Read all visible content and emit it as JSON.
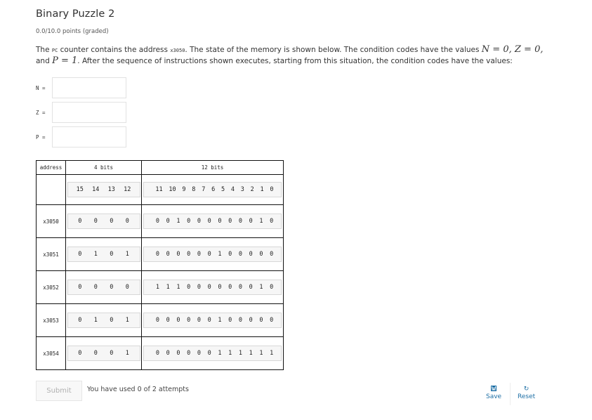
{
  "problem": {
    "title": "Binary Puzzle 2",
    "points": "0.0/10.0 points (graded)",
    "prompt": {
      "part1": "The ",
      "pc_label": "PC",
      "part2": " counter contains the address ",
      "pc_address": "x3050",
      "part3": ". The state of the memory is shown below. The condition codes have the values ",
      "n_var": "N",
      "n_eq": " = 0",
      "comma1": ", ",
      "z_var": "Z",
      "z_eq": " = 0",
      "comma2": ",",
      "part4": "and ",
      "p_var": "P",
      "p_eq": " = 1",
      "part5": ". After the sequence of instructions shown executes, starting from this situation, the condition codes have the values:"
    }
  },
  "condition_codes": [
    {
      "label": "N =",
      "value": "",
      "placeholder": ""
    },
    {
      "label": "Z =",
      "value": "",
      "placeholder": ""
    },
    {
      "label": "P =",
      "value": "",
      "placeholder": ""
    }
  ],
  "memory_table": {
    "headers": {
      "address": "address",
      "high": "4 bits",
      "low": "12 bits"
    },
    "bit_index_high": [
      "15",
      "14",
      "13",
      "12"
    ],
    "bit_index_low": [
      "11",
      "10",
      "9",
      "8",
      "7",
      "6",
      "5",
      "4",
      "3",
      "2",
      "1",
      "0"
    ],
    "rows": [
      {
        "address": "x3050",
        "high": [
          "0",
          "0",
          "0",
          "0"
        ],
        "low": [
          "0",
          "0",
          "1",
          "0",
          "0",
          "0",
          "0",
          "0",
          "0",
          "0",
          "1",
          "0"
        ]
      },
      {
        "address": "x3051",
        "high": [
          "0",
          "1",
          "0",
          "1"
        ],
        "low": [
          "0",
          "0",
          "0",
          "0",
          "0",
          "0",
          "1",
          "0",
          "0",
          "0",
          "0",
          "0"
        ]
      },
      {
        "address": "x3052",
        "high": [
          "0",
          "0",
          "0",
          "0"
        ],
        "low": [
          "1",
          "1",
          "1",
          "0",
          "0",
          "0",
          "0",
          "0",
          "0",
          "0",
          "1",
          "0"
        ]
      },
      {
        "address": "x3053",
        "high": [
          "0",
          "1",
          "0",
          "1"
        ],
        "low": [
          "0",
          "0",
          "0",
          "0",
          "0",
          "0",
          "1",
          "0",
          "0",
          "0",
          "0",
          "0"
        ]
      },
      {
        "address": "x3054",
        "high": [
          "0",
          "0",
          "0",
          "1"
        ],
        "low": [
          "0",
          "0",
          "0",
          "0",
          "0",
          "0",
          "1",
          "1",
          "1",
          "1",
          "1",
          "1"
        ]
      }
    ]
  },
  "footer": {
    "submit_label": "Submit",
    "attempts_text": "You have used 0 of 2 attempts",
    "save_label": "Save",
    "save_icon": "floppy-disk",
    "reset_label": "Reset",
    "reset_icon": "refresh"
  },
  "colors": {
    "link": "#1d6fa5",
    "table_border": "#111111",
    "bitbox_bg": "#f6f6f6"
  }
}
